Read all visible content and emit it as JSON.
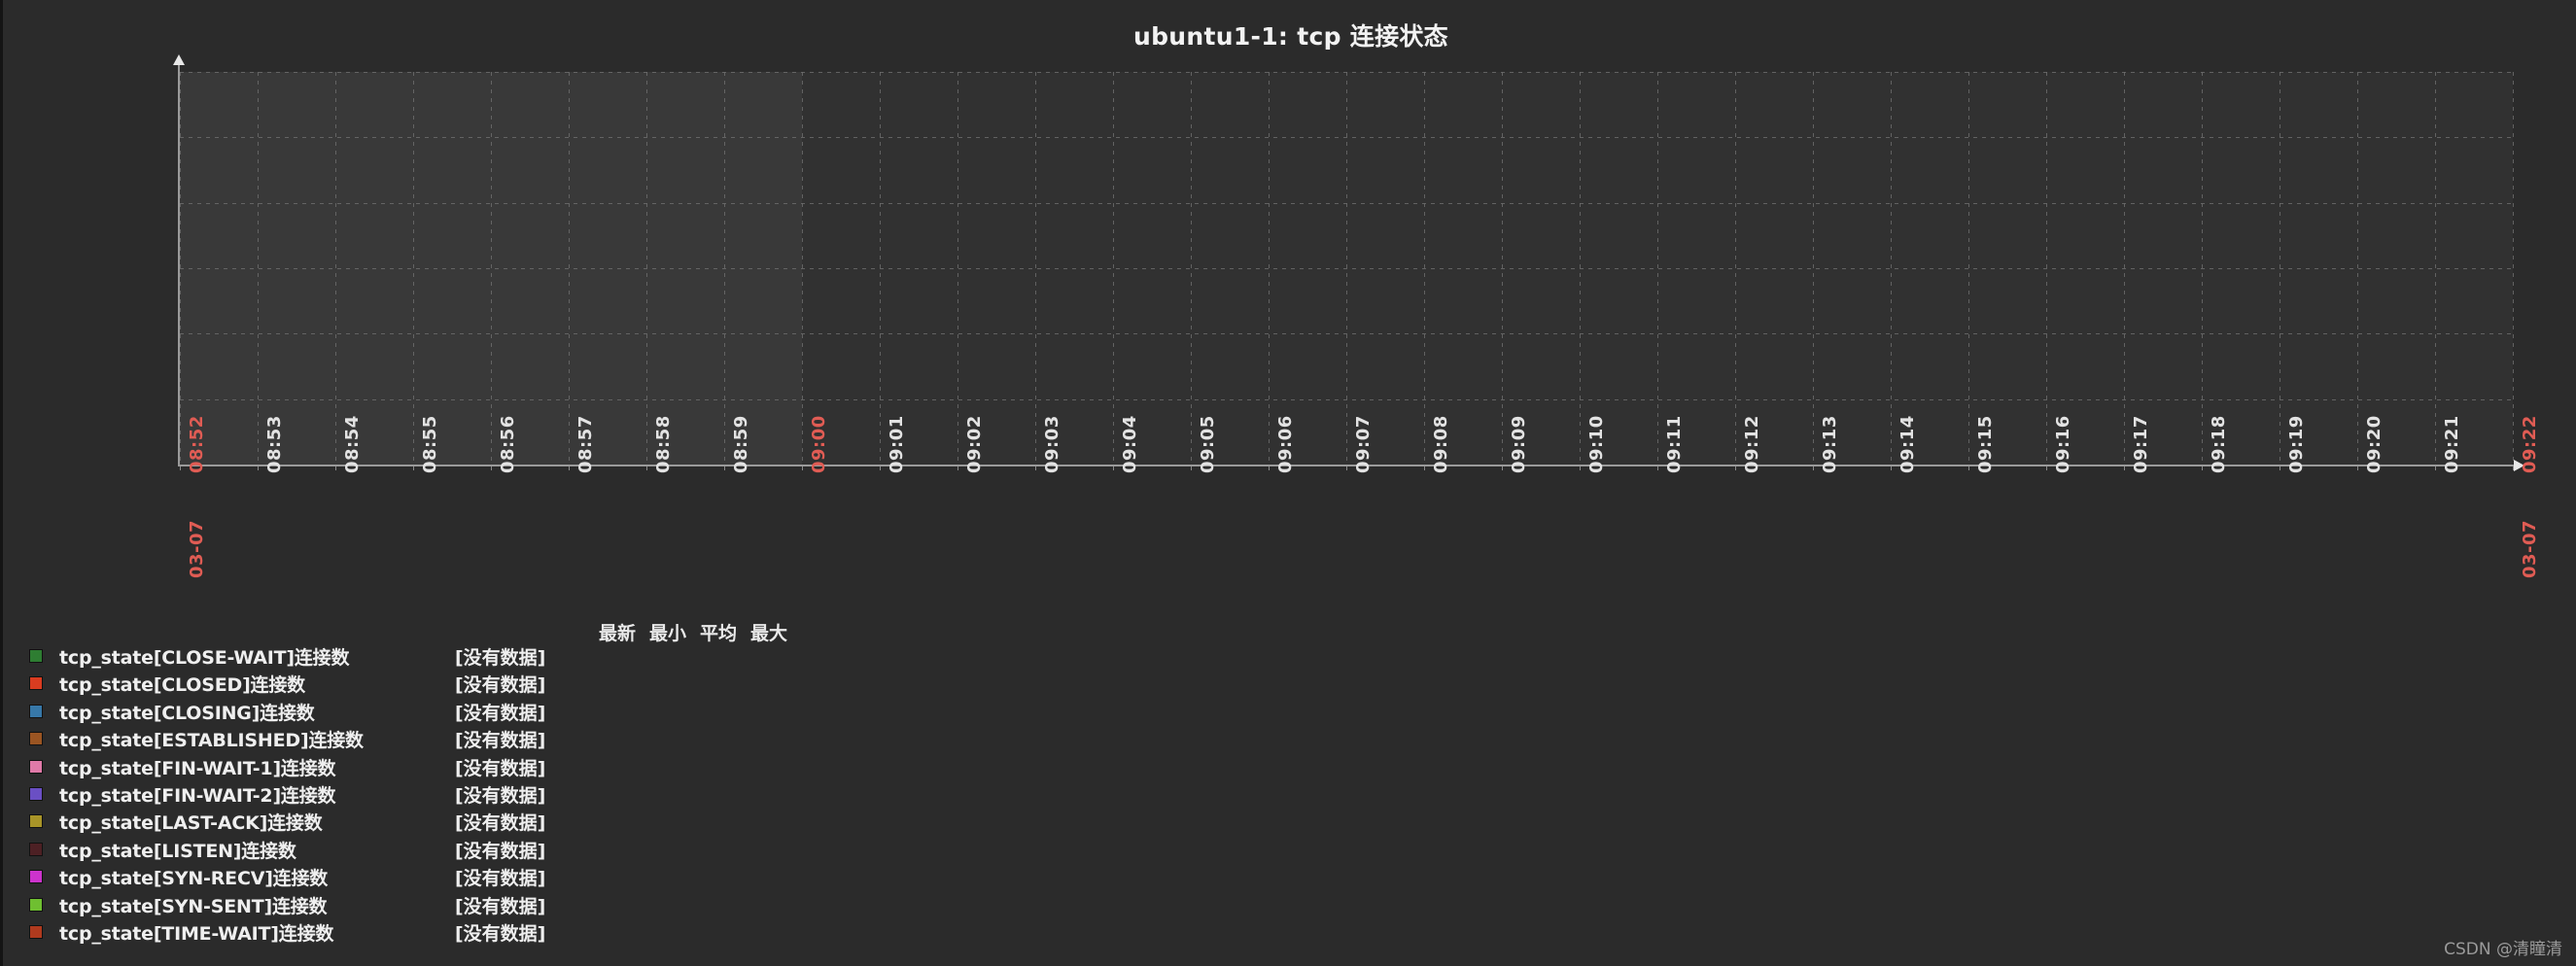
{
  "chart_data": {
    "type": "line",
    "title": "ubuntu1-1: tcp 连接状态",
    "xlabel": "",
    "ylabel": "",
    "ylim": [
      0,
      1.2
    ],
    "y_ticks": [
      "0",
      "0.2",
      "0.4",
      "0.6",
      "0.8",
      "1.0",
      "1.2"
    ],
    "y_tick_values": [
      0,
      0.2,
      0.4,
      0.6,
      0.8,
      1.0,
      1.2
    ],
    "grid": true,
    "legend_position": "bottom-left",
    "x_range_start": "03-07 08:52",
    "x_range_end": "03-07 09:22",
    "x_tick_labels": [
      "08:52",
      "08:53",
      "08:54",
      "08:55",
      "08:56",
      "08:57",
      "08:58",
      "08:59",
      "09:00",
      "09:01",
      "09:02",
      "09:03",
      "09:04",
      "09:05",
      "09:06",
      "09:07",
      "09:08",
      "09:09",
      "09:10",
      "09:11",
      "09:12",
      "09:13",
      "09:14",
      "09:15",
      "09:16",
      "09:17",
      "09:18",
      "09:19",
      "09:20",
      "09:21",
      "09:22"
    ],
    "x_boundary_indices": [
      0,
      8,
      30
    ],
    "x_date_labels": {
      "0": "03-07",
      "30": "03-07"
    },
    "worktime_shading_end_index": 8,
    "series": [
      {
        "name": "tcp_state[CLOSE-WAIT]连接数",
        "color": "#2e7d32",
        "values": [],
        "value_text": "[没有数据]"
      },
      {
        "name": "tcp_state[CLOSED]连接数",
        "color": "#d93c20",
        "values": [],
        "value_text": "[没有数据]"
      },
      {
        "name": "tcp_state[CLOSING]连接数",
        "color": "#3778a8",
        "values": [],
        "value_text": "[没有数据]"
      },
      {
        "name": "tcp_state[ESTABLISHED]连接数",
        "color": "#9a5522",
        "values": [],
        "value_text": "[没有数据]"
      },
      {
        "name": "tcp_state[FIN-WAIT-1]连接数",
        "color": "#e07aa8",
        "values": [],
        "value_text": "[没有数据]"
      },
      {
        "name": "tcp_state[FIN-WAIT-2]连接数",
        "color": "#6a4fc4",
        "values": [],
        "value_text": "[没有数据]"
      },
      {
        "name": "tcp_state[LAST-ACK]连接数",
        "color": "#a89428",
        "values": [],
        "value_text": "[没有数据]"
      },
      {
        "name": "tcp_state[LISTEN]连接数",
        "color": "#4d2024",
        "values": [],
        "value_text": "[没有数据]"
      },
      {
        "name": "tcp_state[SYN-RECV]连接数",
        "color": "#cc33cc",
        "values": [],
        "value_text": "[没有数据]"
      },
      {
        "name": "tcp_state[SYN-SENT]连接数",
        "color": "#6fbf31",
        "values": [],
        "value_text": "[没有数据]"
      },
      {
        "name": "tcp_state[TIME-WAIT]连接数",
        "color": "#b03a1e",
        "values": [],
        "value_text": "[没有数据]"
      }
    ]
  },
  "legend": {
    "headers": [
      {
        "label": "最新",
        "x": 613
      },
      {
        "label": "最小",
        "x": 665
      },
      {
        "label": "平均",
        "x": 717
      },
      {
        "label": "最大",
        "x": 769
      }
    ],
    "rows": [
      {
        "color": "#2e7d32",
        "label": "tcp_state[CLOSE-WAIT]连接数",
        "value": "[没有数据]"
      },
      {
        "color": "#d93c20",
        "label": "tcp_state[CLOSED]连接数",
        "value": "[没有数据]"
      },
      {
        "color": "#3778a8",
        "label": "tcp_state[CLOSING]连接数",
        "value": "[没有数据]"
      },
      {
        "color": "#9a5522",
        "label": "tcp_state[ESTABLISHED]连接数",
        "value": "[没有数据]"
      },
      {
        "color": "#e07aa8",
        "label": "tcp_state[FIN-WAIT-1]连接数",
        "value": "[没有数据]"
      },
      {
        "color": "#6a4fc4",
        "label": "tcp_state[FIN-WAIT-2]连接数",
        "value": "[没有数据]"
      },
      {
        "color": "#a89428",
        "label": "tcp_state[LAST-ACK]连接数",
        "value": "[没有数据]"
      },
      {
        "color": "#4d2024",
        "label": "tcp_state[LISTEN]连接数",
        "value": "[没有数据]"
      },
      {
        "color": "#cc33cc",
        "label": "tcp_state[SYN-RECV]连接数",
        "value": "[没有数据]"
      },
      {
        "color": "#6fbf31",
        "label": "tcp_state[SYN-SENT]连接数",
        "value": "[没有数据]"
      },
      {
        "color": "#b03a1e",
        "label": "tcp_state[TIME-WAIT]连接数",
        "value": "[没有数据]"
      }
    ]
  },
  "watermark": {
    "text": "CSDN @清瞳清"
  },
  "colors": {
    "background": "#2b2b2b",
    "plot_background": "#313131",
    "worktime_background": "#393939",
    "grid": "#6b6b6b",
    "axis": "#9a9a9a",
    "text": "#f2f2f2",
    "boundary_label": "#e05c54"
  }
}
